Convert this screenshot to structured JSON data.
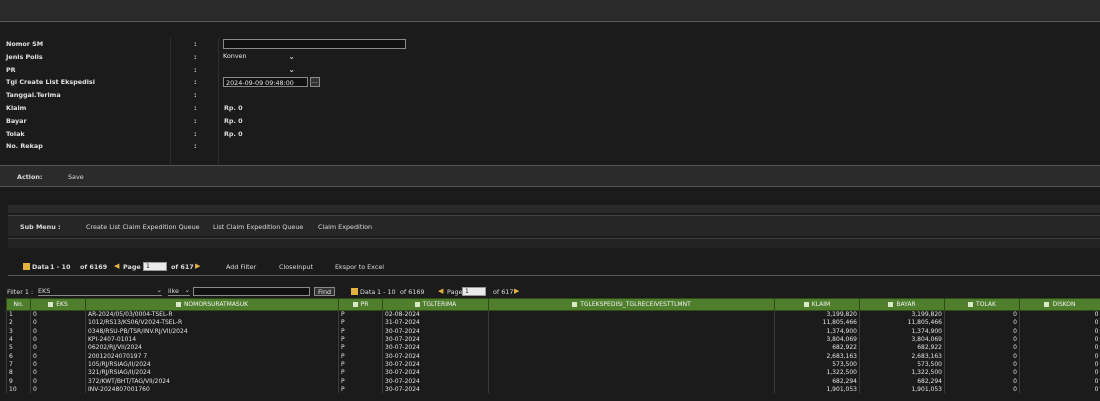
{
  "form": {
    "nomor_sm": {
      "label": "Nomor SM",
      "value": ""
    },
    "jenis_polis": {
      "label": "Jenis Polis",
      "value": "Konven"
    },
    "pr": {
      "label": "PR",
      "value": ""
    },
    "tgl_create": {
      "label": "Tgl Create List Ekspedisi",
      "value": "2024-09-09 09:48:00",
      "button": "..."
    },
    "tanggal_terima": {
      "label": "Tanggal.Terima",
      "value": ""
    },
    "klaim": {
      "label": "Klaim",
      "value": "Rp. 0"
    },
    "bayar": {
      "label": "Bayar",
      "value": "Rp. 0"
    },
    "tolak": {
      "label": "Tolak",
      "value": "Rp. 0"
    },
    "no_rekap": {
      "label": "No. Rekap",
      "value": ""
    },
    "colon": ":"
  },
  "action": {
    "label": "Action:",
    "save": "Save"
  },
  "submenu": {
    "label": "Sub Menu :",
    "items": [
      "Create List Claim Expedition Queue",
      "List Claim Expedition Queue",
      "Claim Expedition"
    ]
  },
  "pager": {
    "data_label": "Data",
    "range": "1 - 10",
    "of_total": "of 6169",
    "page_label": "Page",
    "page_value": "1",
    "of_pages": "of 617",
    "add_filter": "Add Filter",
    "close_input": "CloseInput",
    "export": "Ekspor to Excel"
  },
  "filter": {
    "label": "Filter 1 :",
    "field": "EKS",
    "op": "like",
    "value": "",
    "find": "Find",
    "data_label": "Data",
    "range": "1 - 10",
    "of_total": "of 6169",
    "page_label": "Page",
    "page_value": "1",
    "of_pages": "of 617"
  },
  "table": {
    "headers": [
      "No.",
      "EKS",
      "NOMORSURATMASUK",
      "PR",
      "TGLTERIMA",
      "TGLEKSPEDISI_TGLRECEIVESTTLMNT",
      "KLAIM",
      "BAYAR",
      "TOLAK",
      "DISKON"
    ],
    "rows": [
      [
        "1",
        "0",
        "AR-2024/05/03/0004-TSEL-R",
        "P",
        "02-08-2024",
        "",
        "3,199,820",
        "3,199,820",
        "0",
        "0"
      ],
      [
        "2",
        "0",
        "1012/RS13/KS06/V2024-TSEL-R",
        "P",
        "31-07-2024",
        "",
        "11,805,466",
        "11,805,466",
        "0",
        "0"
      ],
      [
        "3",
        "0",
        "0348/RSU-PB/TSR/INV.RJ/VII/2024",
        "P",
        "30-07-2024",
        "",
        "1,374,900",
        "1,374,900",
        "0",
        "0"
      ],
      [
        "4",
        "0",
        "KPI-2407-01014",
        "P",
        "30-07-2024",
        "",
        "3,804,069",
        "3,804,069",
        "0",
        "0"
      ],
      [
        "5",
        "0",
        "06202/RJ/VII/2024",
        "P",
        "30-07-2024",
        "",
        "682,922",
        "682,922",
        "0",
        "0"
      ],
      [
        "6",
        "0",
        "20012024070197 7",
        "P",
        "30-07-2024",
        "",
        "2,683,163",
        "2,683,163",
        "0",
        "0"
      ],
      [
        "7",
        "0",
        "105/RJ/RSIAG/II/2024",
        "P",
        "30-07-2024",
        "",
        "573,500",
        "573,500",
        "0",
        "0"
      ],
      [
        "8",
        "0",
        "321/RJ/RSIAG/II/2024",
        "P",
        "30-07-2024",
        "",
        "1,322,500",
        "1,322,500",
        "0",
        "0"
      ],
      [
        "9",
        "0",
        "372/KWT/BHT/TAG/VII/2024",
        "P",
        "30-07-2024",
        "",
        "682,294",
        "682,294",
        "0",
        "0"
      ],
      [
        "10",
        "0",
        "INV-2024807001760",
        "P",
        "30-07-2024",
        "",
        "1,901,053",
        "1,901,053",
        "0",
        "0"
      ]
    ]
  }
}
